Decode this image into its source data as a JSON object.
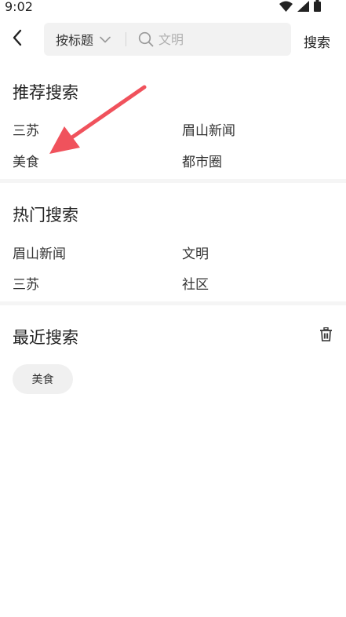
{
  "status_bar": {
    "time": "9:02",
    "icons": [
      "wifi-icon",
      "signal-icon",
      "battery-icon"
    ]
  },
  "top_bar": {
    "back_icon": "chevron-left-icon",
    "search_type": "按标题",
    "search_placeholder": "文明",
    "search_button": "搜索"
  },
  "recommended": {
    "title": "推荐搜索",
    "items": [
      "三苏",
      "眉山新闻",
      "美食",
      "都市圈"
    ]
  },
  "hot": {
    "title": "热门搜索",
    "items": [
      "眉山新闻",
      "文明",
      "三苏",
      "社区"
    ]
  },
  "recent": {
    "title": "最近搜索",
    "delete_icon": "trash-icon",
    "chips": [
      "美食"
    ]
  },
  "annotation": {
    "arrow_color": "#f0525c"
  },
  "colors": {
    "text": "#222222",
    "secondary": "#333333",
    "placeholder": "#b0b0b0",
    "search_bg": "#f2f2f2",
    "chip_bg": "#f0f0f0",
    "band": "#f5f5f5"
  }
}
